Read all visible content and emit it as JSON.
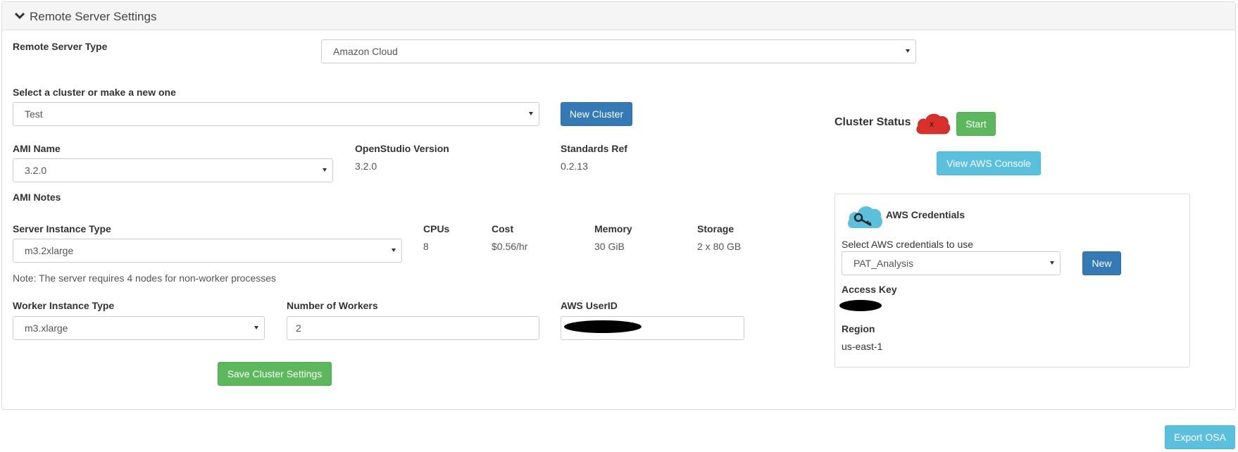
{
  "panel": {
    "title": "Remote Server Settings"
  },
  "remote_server_type": {
    "label": "Remote Server Type",
    "value": "Amazon Cloud"
  },
  "cluster": {
    "label": "Select a cluster or make a new one",
    "value": "Test",
    "new_button": "New Cluster"
  },
  "ami": {
    "label": "AMI Name",
    "value": "3.2.0",
    "notes_label": "AMI Notes"
  },
  "openstudio_version": {
    "label": "OpenStudio Version",
    "value": "3.2.0"
  },
  "standards_ref": {
    "label": "Standards Ref",
    "value": "0.2.13"
  },
  "server_instance": {
    "label": "Server Instance Type",
    "value": "m3.2xlarge",
    "cpus_label": "CPUs",
    "cpus": "8",
    "cost_label": "Cost",
    "cost": "$0.56/hr",
    "memory_label": "Memory",
    "memory": "30 GiB",
    "storage_label": "Storage",
    "storage": "2 x 80 GB",
    "note": "Note: The server requires 4 nodes for non-worker processes"
  },
  "worker_instance": {
    "label": "Worker Instance Type",
    "value": "m3.xlarge"
  },
  "workers": {
    "label": "Number of Workers",
    "value": "2"
  },
  "aws_userid": {
    "label": "AWS UserID"
  },
  "save_button": "Save Cluster Settings",
  "cluster_status": {
    "label": "Cluster Status",
    "status_icon_text": "x",
    "start_button": "Start",
    "view_console_button": "View AWS Console"
  },
  "credentials": {
    "title": "AWS Credentials",
    "select_label": "Select AWS credentials to use",
    "select_value": "PAT_Analysis",
    "new_button": "New",
    "access_key_label": "Access Key",
    "region_label": "Region",
    "region_value": "us-east-1"
  },
  "export_button": "Export OSA",
  "colors": {
    "primary": "#337ab7",
    "success": "#5cb85c",
    "info": "#5bc0de",
    "status_red": "#d9302c",
    "cloud_blue": "#5bc0de"
  }
}
